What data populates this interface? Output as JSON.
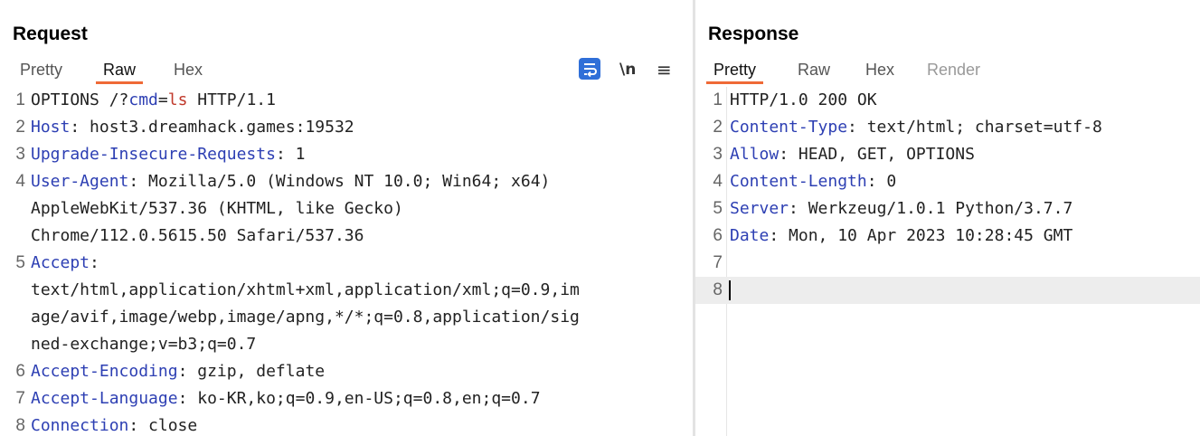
{
  "request": {
    "title": "Request",
    "tabs": [
      "Pretty",
      "Raw",
      "Hex"
    ],
    "active_tab": "Raw",
    "icons": {
      "wrap": "wrap-lines-icon",
      "newline": "\\n",
      "menu": "≡"
    },
    "lines": [
      {
        "n": "1",
        "parts": [
          {
            "t": "OPTIONS /?"
          },
          {
            "t": "cmd",
            "c": "key"
          },
          {
            "t": "="
          },
          {
            "t": "ls",
            "c": "param"
          },
          {
            "t": " HTTP/1.1"
          }
        ]
      },
      {
        "n": "2",
        "parts": [
          {
            "t": "Host",
            "c": "key"
          },
          {
            "t": ": host3.dreamhack.games:19532"
          }
        ]
      },
      {
        "n": "3",
        "parts": [
          {
            "t": "Upgrade-Insecure-Requests",
            "c": "key"
          },
          {
            "t": ": 1"
          }
        ]
      },
      {
        "n": "4",
        "parts": [
          {
            "t": "User-Agent",
            "c": "key"
          },
          {
            "t": ": Mozilla/5.0 (Windows NT 10.0; Win64; x64)"
          }
        ]
      },
      {
        "n": "",
        "parts": [
          {
            "t": "AppleWebKit/537.36 (KHTML, like Gecko)"
          }
        ]
      },
      {
        "n": "",
        "parts": [
          {
            "t": "Chrome/112.0.5615.50 Safari/537.36"
          }
        ]
      },
      {
        "n": "5",
        "parts": [
          {
            "t": "Accept",
            "c": "key"
          },
          {
            "t": ":"
          }
        ]
      },
      {
        "n": "",
        "parts": [
          {
            "t": "text/html,application/xhtml+xml,application/xml;q=0.9,im"
          }
        ]
      },
      {
        "n": "",
        "parts": [
          {
            "t": "age/avif,image/webp,image/apng,*/*;q=0.8,application/sig"
          }
        ]
      },
      {
        "n": "",
        "parts": [
          {
            "t": "ned-exchange;v=b3;q=0.7"
          }
        ]
      },
      {
        "n": "6",
        "parts": [
          {
            "t": "Accept-Encoding",
            "c": "key"
          },
          {
            "t": ": gzip, deflate"
          }
        ]
      },
      {
        "n": "7",
        "parts": [
          {
            "t": "Accept-Language",
            "c": "key"
          },
          {
            "t": ": ko-KR,ko;q=0.9,en-US;q=0.8,en;q=0.7"
          }
        ]
      },
      {
        "n": "8",
        "parts": [
          {
            "t": "Connection",
            "c": "key"
          },
          {
            "t": ": close"
          }
        ]
      }
    ]
  },
  "response": {
    "title": "Response",
    "tabs": [
      "Pretty",
      "Raw",
      "Hex",
      "Render"
    ],
    "active_tab": "Pretty",
    "disabled_tabs": [
      "Render"
    ],
    "lines": [
      {
        "n": "1",
        "parts": [
          {
            "t": "HTTP/1.0 200 OK"
          }
        ]
      },
      {
        "n": "2",
        "parts": [
          {
            "t": "Content-Type",
            "c": "key"
          },
          {
            "t": ": text/html; charset=utf-8"
          }
        ]
      },
      {
        "n": "3",
        "parts": [
          {
            "t": "Allow",
            "c": "key"
          },
          {
            "t": ": HEAD, GET, OPTIONS"
          }
        ]
      },
      {
        "n": "4",
        "parts": [
          {
            "t": "Content-Length",
            "c": "key"
          },
          {
            "t": ": 0"
          }
        ]
      },
      {
        "n": "5",
        "parts": [
          {
            "t": "Server",
            "c": "key"
          },
          {
            "t": ": Werkzeug/1.0.1 Python/3.7.7"
          }
        ]
      },
      {
        "n": "6",
        "parts": [
          {
            "t": "Date",
            "c": "key"
          },
          {
            "t": ": Mon, 10 Apr 2023 10:28:45 GMT"
          }
        ]
      },
      {
        "n": "7",
        "parts": []
      },
      {
        "n": "8",
        "parts": [],
        "current": true
      }
    ]
  },
  "colors": {
    "accent": "#ef6a37",
    "key": "#2d3fb3",
    "param": "#c0392b",
    "wrap_button": "#2f6fd8"
  }
}
